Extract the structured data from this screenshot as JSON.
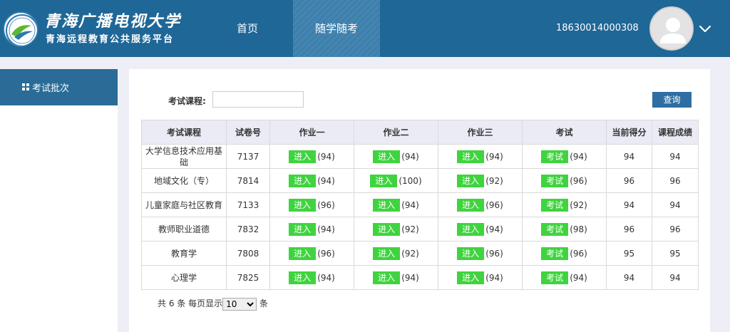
{
  "header": {
    "brand_title": "青海广播电视大学",
    "brand_subtitle": "青海远程教育公共服务平台",
    "nav": [
      {
        "label": "首页",
        "active": false
      },
      {
        "label": "随学随考",
        "active": true
      }
    ],
    "user_id": "18630014000308",
    "accent_color": "#1f6797"
  },
  "sidebar": {
    "items": [
      {
        "label": "考试批次",
        "icon": "grid-icon",
        "active": true
      }
    ]
  },
  "filter": {
    "label": "考试课程:",
    "value": "",
    "placeholder": "",
    "query_label": "查询"
  },
  "table": {
    "columns": [
      "考试课程",
      "试卷号",
      "作业一",
      "作业二",
      "作业三",
      "考试",
      "当前得分",
      "课程成绩"
    ],
    "enter_label": "进入",
    "exam_label": "考试",
    "button_color": "#3fd43f",
    "rows": [
      {
        "course": "大学信息技术应用基础",
        "paper": "7137",
        "hw1": "(94)",
        "hw2": "(94)",
        "hw3": "(94)",
        "exam": "(94)",
        "current": "94",
        "grade": "94"
      },
      {
        "course": "地域文化（专）",
        "paper": "7814",
        "hw1": "(94)",
        "hw2": "(100)",
        "hw3": "(92)",
        "exam": "(96)",
        "current": "96",
        "grade": "96"
      },
      {
        "course": "儿童家庭与社区教育",
        "paper": "7133",
        "hw1": "(96)",
        "hw2": "(94)",
        "hw3": "(96)",
        "exam": "(92)",
        "current": "94",
        "grade": "94"
      },
      {
        "course": "教师职业道德",
        "paper": "7832",
        "hw1": "(94)",
        "hw2": "(92)",
        "hw3": "(94)",
        "exam": "(98)",
        "current": "96",
        "grade": "96"
      },
      {
        "course": "教育学",
        "paper": "7808",
        "hw1": "(96)",
        "hw2": "(92)",
        "hw3": "(96)",
        "exam": "(96)",
        "current": "95",
        "grade": "95"
      },
      {
        "course": "心理学",
        "paper": "7825",
        "hw1": "(94)",
        "hw2": "(94)",
        "hw3": "(94)",
        "exam": "(94)",
        "current": "94",
        "grade": "94"
      }
    ]
  },
  "pager": {
    "total_prefix": "共",
    "total": "6",
    "total_suffix": "条 每页显示",
    "page_size": "10",
    "page_size_options": [
      "10"
    ],
    "unit": "条"
  }
}
